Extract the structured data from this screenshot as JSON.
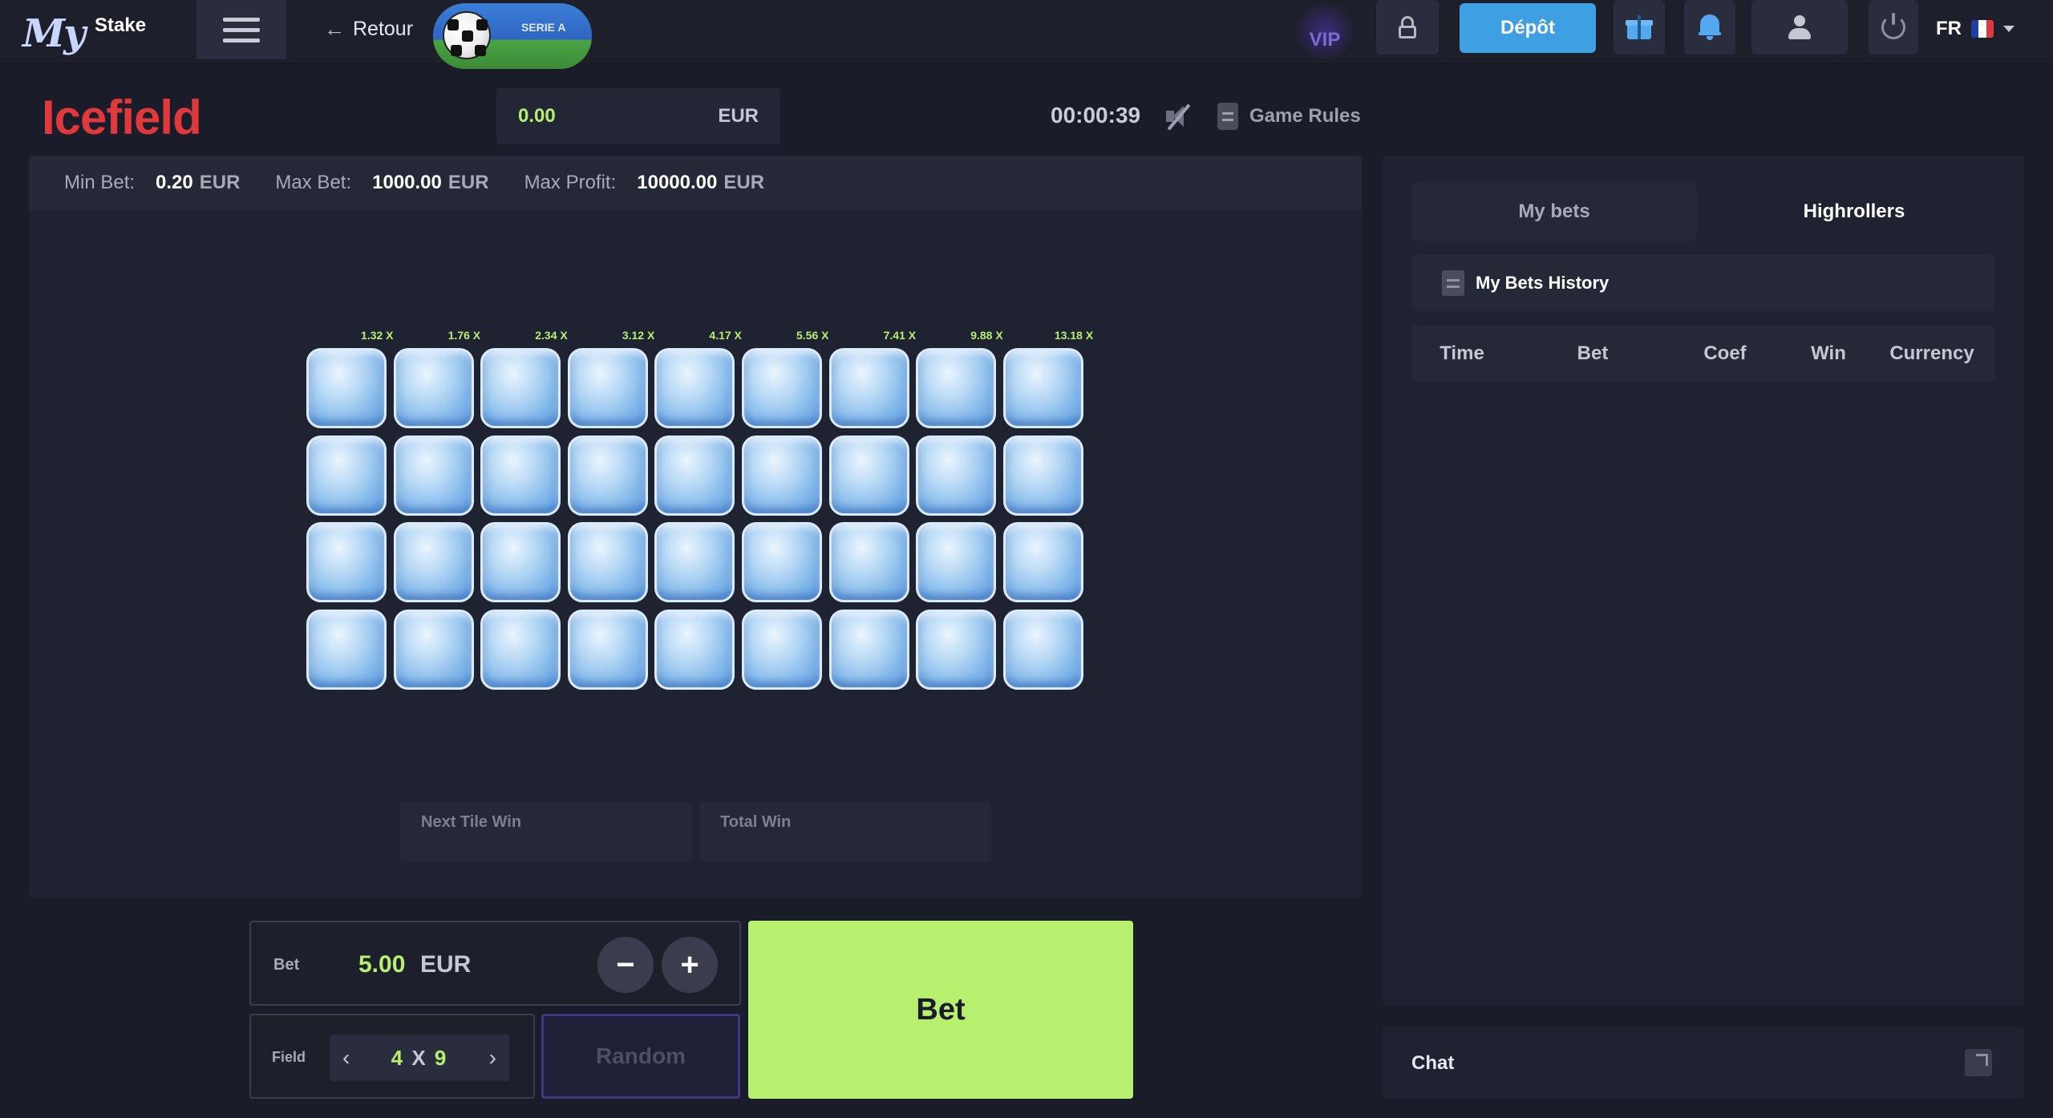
{
  "header": {
    "logo_my": "My",
    "logo_stake": "Stake",
    "back_label": "Retour",
    "promo_label": "SERIE A",
    "vip_label": "VIP",
    "deposit_label": "Dépôt",
    "language": "FR",
    "flag_colors": [
      "#1f3fa8",
      "#ffffff",
      "#e0393d"
    ]
  },
  "game": {
    "title": "Icefield",
    "balance_amount": "0.00",
    "balance_currency": "EUR",
    "timer": "00:00:39",
    "rules_label": "Game Rules",
    "limits": {
      "min_label": "Min Bet:",
      "min_value": "0.20",
      "min_currency": "EUR",
      "max_label": "Max Bet:",
      "max_value": "1000.00",
      "max_currency": "EUR",
      "profit_label": "Max Profit:",
      "profit_value": "10000.00",
      "profit_currency": "EUR"
    },
    "multipliers": [
      "1.32 X",
      "1.76 X",
      "2.34 X",
      "3.12 X",
      "4.17 X",
      "5.56 X",
      "7.41 X",
      "9.88 X",
      "13.18 X"
    ],
    "grid_rows": 4,
    "grid_cols": 9,
    "next_tile_win_label": "Next Tile Win",
    "total_win_label": "Total Win"
  },
  "controls": {
    "bet_label": "Bet",
    "bet_amount": "5.00",
    "bet_currency": "EUR",
    "minus": "−",
    "plus": "+",
    "field_label": "Field",
    "field_rows": "4",
    "field_x": "X",
    "field_cols": "9",
    "prev": "‹",
    "next": "›",
    "random_label": "Random",
    "bet_button": "Bet"
  },
  "sidebar": {
    "tab_my_bets": "My bets",
    "tab_highrollers": "Highrollers",
    "history_title": "My Bets History",
    "columns": [
      "Time",
      "Bet",
      "Coef",
      "Win",
      "Currency"
    ],
    "chat_label": "Chat"
  },
  "colors": {
    "accent_green": "#b7ef6f",
    "title_red": "#e0393d",
    "deposit_blue": "#3f9fe3"
  }
}
